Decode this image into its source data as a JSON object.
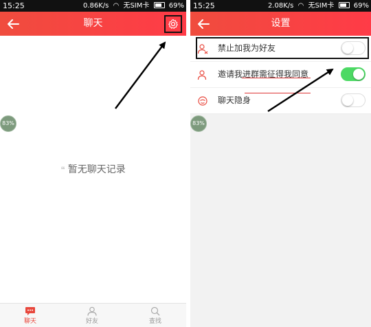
{
  "left_screen": {
    "status": {
      "time": "15:25",
      "speed": "0.86K/s",
      "sim": "无SIM卡",
      "battery": "69%"
    },
    "title": "聊天",
    "empty_text": "暂无聊天记录",
    "badge": "83%",
    "tabs": [
      {
        "label": "聊天",
        "icon": "chat-icon",
        "active": true
      },
      {
        "label": "好友",
        "icon": "friends-icon",
        "active": false
      },
      {
        "label": "查找",
        "icon": "search-icon",
        "active": false
      }
    ]
  },
  "right_screen": {
    "status": {
      "time": "15:25",
      "speed": "2.08K/s",
      "sim": "无SIM卡",
      "battery": "69%"
    },
    "title": "设置",
    "badge": "83%",
    "settings": [
      {
        "label": "禁止加我为好友",
        "icon": "user-block-icon",
        "enabled": false
      },
      {
        "label": "邀请我进群需征得我同意",
        "icon": "user-invite-icon",
        "enabled": true
      },
      {
        "label": "聊天隐身",
        "icon": "stealth-icon",
        "enabled": false
      }
    ]
  },
  "colors": {
    "accent": "#f04c3e",
    "toggle_on": "#4cd964"
  }
}
